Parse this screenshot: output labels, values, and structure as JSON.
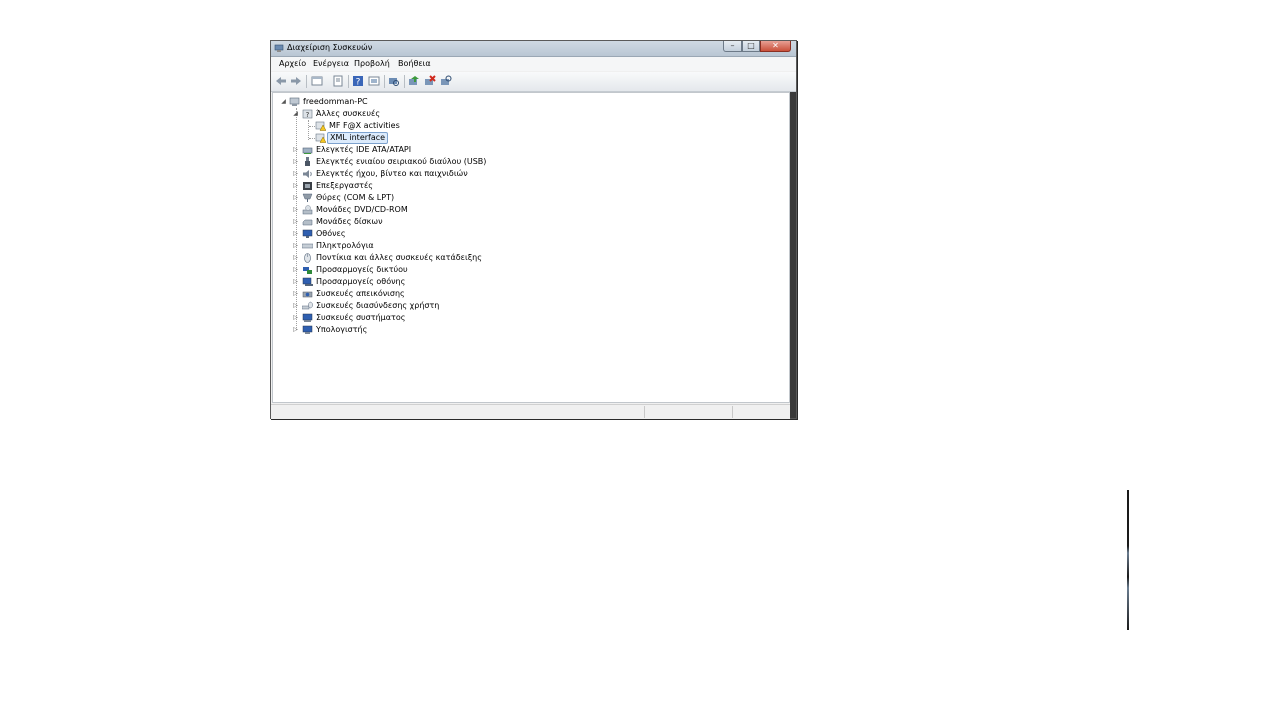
{
  "window": {
    "title": "Διαχείριση Συσκευών",
    "controls": {
      "minimize": "–",
      "maximize": "□",
      "close": "✕"
    }
  },
  "menu": [
    "Αρχείο",
    "Ενέργεια",
    "Προβολή",
    "Βοήθεια"
  ],
  "toolbar": {
    "icons": [
      "back-arrow-icon",
      "forward-arrow-icon",
      "properties-icon",
      "details-icon",
      "help-icon",
      "view-icon",
      "scan-hardware-icon",
      "update-driver-icon",
      "uninstall-icon",
      "disable-icon"
    ]
  },
  "tree": {
    "root": "freedomman-PC",
    "other_devices": {
      "label": "Άλλες συσκευές",
      "children": [
        "MF F@X activities",
        "XML interface"
      ]
    },
    "categories": [
      "Ελεγκτές IDE ATA/ATAPI",
      "Ελεγκτές ενιαίου σειριακού διαύλου (USB)",
      "Ελεγκτές ήχου, βίντεο και παιχνιδιών",
      "Επεξεργαστές",
      "Θύρες (COM & LPT)",
      "Μονάδες DVD/CD-ROM",
      "Μονάδες δίσκων",
      "Οθόνες",
      "Πληκτρολόγια",
      "Ποντίκια και άλλες συσκευές κατάδειξης",
      "Προσαρμογείς δικτύου",
      "Προσαρμογείς οθόνης",
      "Συσκευές απεικόνισης",
      "Συσκευές διασύνδεσης χρήστη",
      "Συσκευές συστήματος",
      "Υπολογιστής"
    ]
  },
  "colors": {
    "selection": "#dcebfc",
    "selection_border": "#7da2ce",
    "close_button": "#c9503b"
  }
}
